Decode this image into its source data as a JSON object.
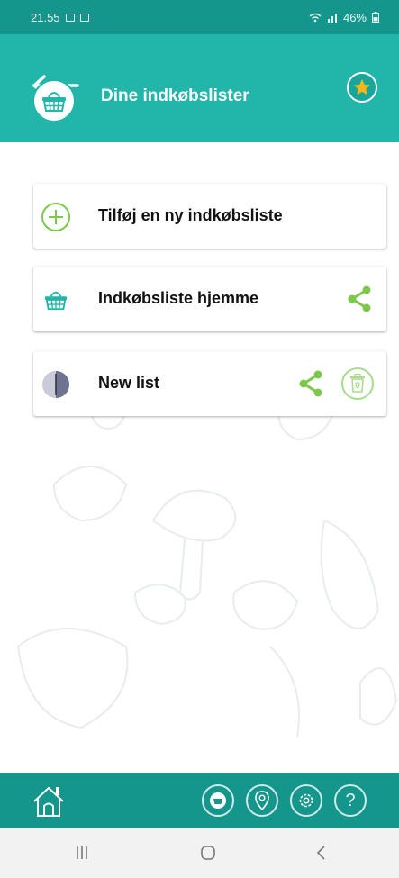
{
  "status_bar": {
    "time": "21.55",
    "battery": "46%"
  },
  "header": {
    "title": "Dine indkøbslister"
  },
  "lists": [
    {
      "label": "Tilføj en ny indkøbsliste",
      "icon": "add-circle-icon"
    },
    {
      "label": "Indkøbsliste hjemme",
      "icon": "basket-icon",
      "actions": [
        "share-icon"
      ]
    },
    {
      "label": "New list",
      "icon": "list-avatar-icon",
      "actions": [
        "share-icon",
        "trash-icon"
      ]
    }
  ],
  "bottom_nav": {
    "items": [
      "home-icon",
      "basket-icon",
      "location-pin-icon",
      "settings-gear-icon",
      "help-icon"
    ],
    "help_label": "?"
  },
  "colors": {
    "teal_dark": "#14968c",
    "teal": "#22b5a9",
    "green_accent": "#7cc84a",
    "star": "#f4b71e"
  }
}
